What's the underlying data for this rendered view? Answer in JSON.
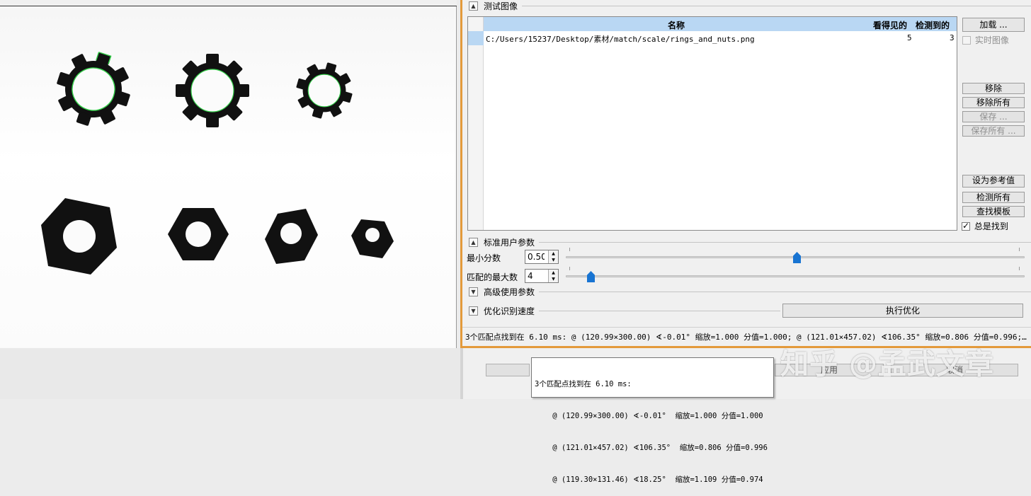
{
  "test_images": {
    "section_title": "测试图像",
    "columns": {
      "name": "名称",
      "seen": "看得见的",
      "detected": "检测到的"
    },
    "rows": [
      {
        "name": "C:/Users/15237/Desktop/素材/match/scale/rings_and_nuts.png",
        "seen": "5",
        "detected": "3"
      }
    ],
    "buttons": {
      "load": "加载 ...",
      "remove": "移除",
      "remove_all": "移除所有",
      "save": "保存 ...",
      "save_all": "保存所有 ...",
      "set_reference": "设为参考值",
      "detect_all": "检测所有",
      "find_model": "查找模板"
    },
    "live_image_label": "实时图像",
    "always_find_label": "总是找到",
    "always_find_checked": true
  },
  "standard_params": {
    "section_title": "标准用户参数",
    "min_score_label": "最小分数",
    "min_score_value": "0.50",
    "min_score_slider": 0.5,
    "max_matches_label": "匹配的最大数",
    "max_matches_value": "4",
    "max_matches_slider": 0.04
  },
  "advanced": {
    "section_title": "高级使用参数"
  },
  "optimize": {
    "section_title": "优化识别速度",
    "run_button": "执行优化"
  },
  "status_text": "3个匹配点找到在 6.10 ms: @ (120.99×300.00) ∢-0.01°  缩放=1.000 分值=1.000; @ (121.01×457.02) ∢106.35°  缩放=0.806 分值=0.996;…",
  "tooltip": {
    "line1": "3个匹配点找到在 6.10 ms:",
    "line2": "    @ (120.99×300.00) ∢-0.01°  缩放=1.000 分值=1.000",
    "line3": "    @ (121.01×457.02) ∢106.35°  缩放=0.806 分值=0.996",
    "line4": "    @ (119.30×131.46) ∢18.25°  缩放=1.109 分值=0.974"
  },
  "under_buttons": {
    "apply": "应用",
    "cancel": "取消"
  },
  "watermark": "知乎 @孟武文章",
  "colors": {
    "accent_border": "#e39a3b",
    "header_blue": "#b9d7f3",
    "slider_blue": "#1874d2",
    "match_green": "#2ecc40"
  }
}
